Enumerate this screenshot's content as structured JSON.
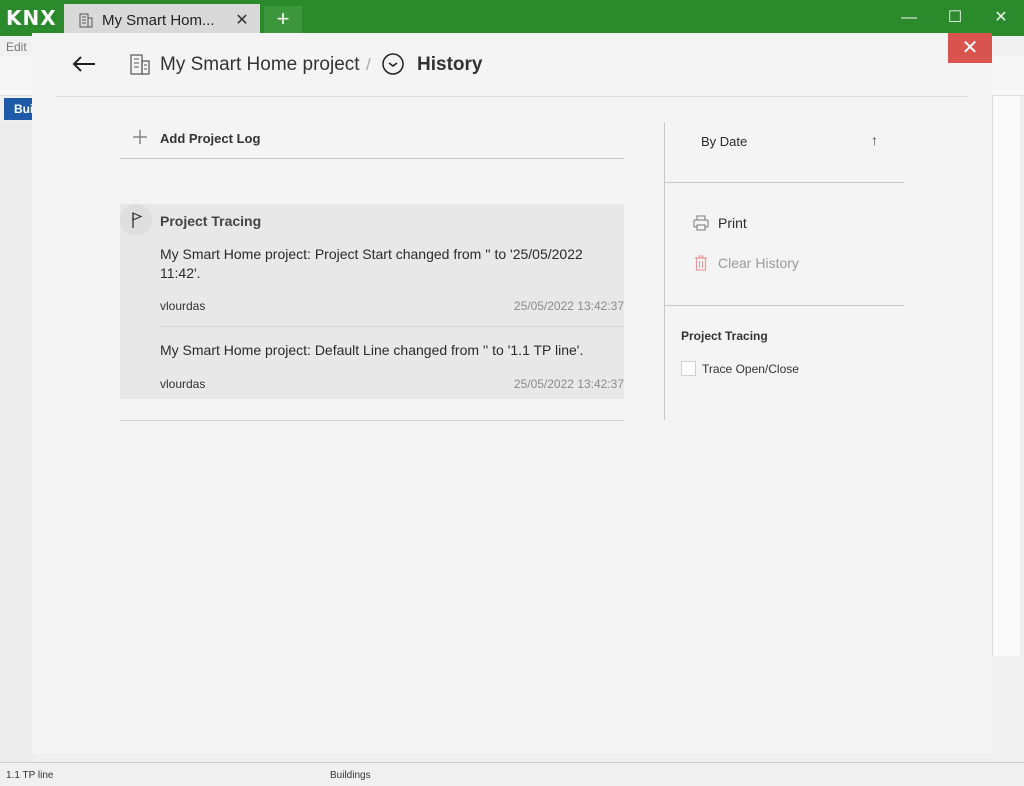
{
  "window": {
    "logo": "KNX",
    "tab_label": "My Smart Hom...",
    "tab_close": "✕",
    "new_tab": "+",
    "minimize": "—",
    "maximize": "☐",
    "close": "✕"
  },
  "background": {
    "menu_edit": "Edit",
    "panel_tab": "Bui",
    "status_left": "1.1 TP line",
    "status_mid": "Buildings"
  },
  "modal": {
    "close": "✕",
    "breadcrumb": {
      "project": "My Smart Home project",
      "separator": "/",
      "current": "History"
    },
    "add_log_label": "Add Project Log",
    "log_group": {
      "title": "Project Tracing",
      "entries": [
        {
          "text": "My Smart Home project: Project Start changed from '' to '25/05/2022 11:42'.",
          "user": "vlourdas",
          "date": "25/05/2022 13:42:37"
        },
        {
          "text": "My Smart Home project: Default Line changed from '' to '1.1 TP line'.",
          "user": "vlourdas",
          "date": "25/05/2022 13:42:37"
        }
      ]
    },
    "sort": {
      "label": "By Date",
      "direction_icon": "↑"
    },
    "actions": {
      "print": "Print",
      "clear_history": "Clear History"
    },
    "tracing": {
      "title": "Project Tracing",
      "option": "Trace Open/Close",
      "checked": false
    },
    "colors": {
      "accent_green": "#2b8a2b",
      "close_red": "#d9534f",
      "disabled": "#8a8a8a"
    }
  }
}
